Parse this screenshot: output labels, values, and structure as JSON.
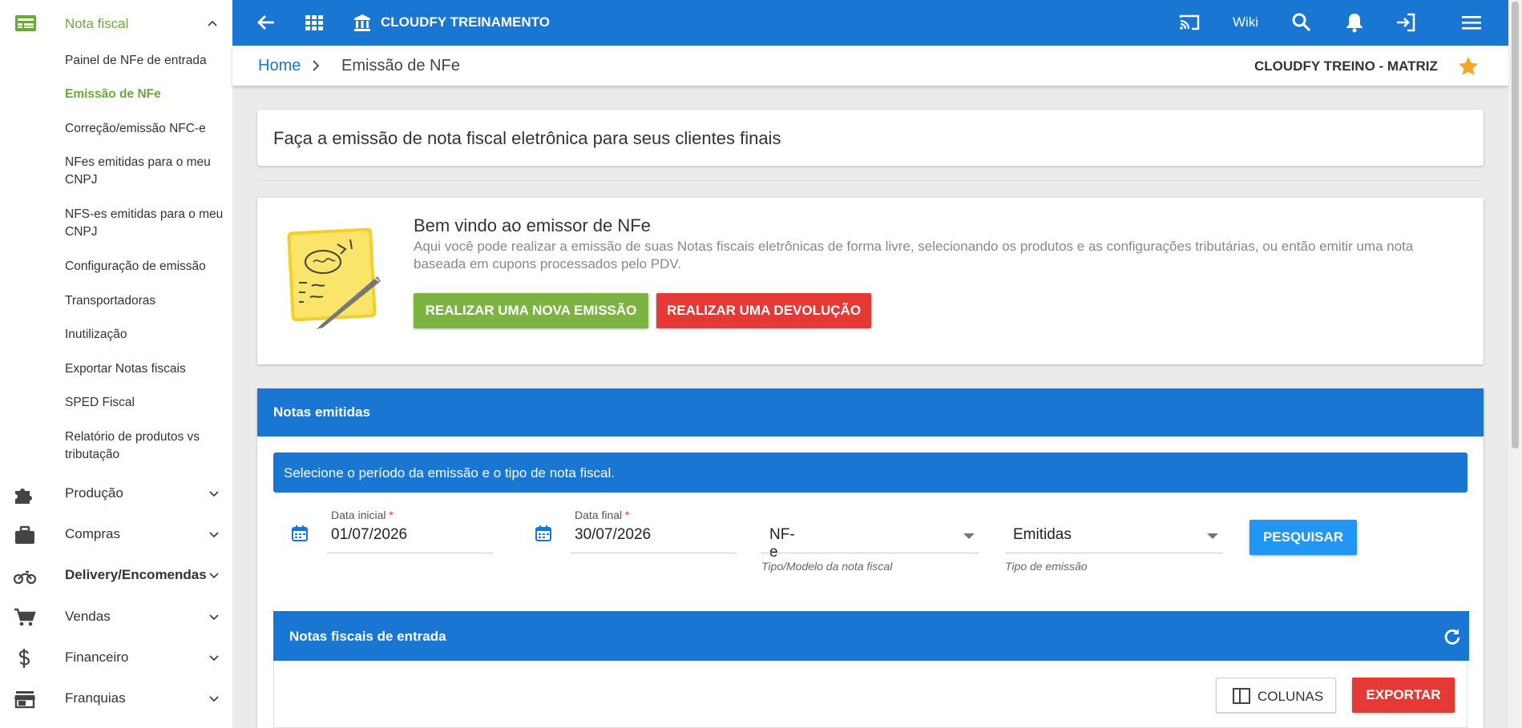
{
  "sidebar": {
    "section_title": "Nota fiscal",
    "sub_items": [
      {
        "label": "Painel de NFe de entrada",
        "active": false
      },
      {
        "label": "Emissão de NFe",
        "active": true
      },
      {
        "label": "Correção/emissão NFC-e",
        "active": false
      },
      {
        "label": "NFes emitidas para o meu CNPJ",
        "active": false
      },
      {
        "label": "NFS-es emitidas para o meu CNPJ",
        "active": false
      },
      {
        "label": "Configuração de emissão",
        "active": false
      },
      {
        "label": "Transportadoras",
        "active": false
      },
      {
        "label": "Inutilização",
        "active": false
      },
      {
        "label": "Exportar Notas fiscais",
        "active": false
      },
      {
        "label": "SPED Fiscal",
        "active": false
      },
      {
        "label": "Relatório de produtos vs tributação",
        "active": false
      }
    ],
    "sections": [
      {
        "label": "Produção",
        "icon": "puzzle-icon"
      },
      {
        "label": "Compras",
        "icon": "briefcase-icon"
      },
      {
        "label": "Delivery/Encomendas",
        "icon": "motorcycle-icon"
      },
      {
        "label": "Vendas",
        "icon": "cart-icon"
      },
      {
        "label": "Financeiro",
        "icon": "dollar-icon"
      },
      {
        "label": "Franquias",
        "icon": "store-icon"
      }
    ],
    "accent": "#6aaa3a"
  },
  "topbar": {
    "brand": "CLOUDFY TREINAMENTO",
    "wiki": "Wiki",
    "color": "#1976d2"
  },
  "breadcrumb": {
    "home": "Home",
    "current": "Emissão de NFe",
    "company": "CLOUDFY TREINO - MATRIZ"
  },
  "intro": {
    "text": "Faça a emissão de nota fiscal eletrônica para seus clientes finais"
  },
  "welcome": {
    "title": "Bem vindo ao emissor de NFe",
    "description": "Aqui você pode realizar a emissão de suas Notas fiscais eletrônicas de forma livre, selecionando os produtos e as configurações tributárias, ou então emitir uma nota baseada em cupons processados pelo PDV.",
    "new_button": "REALIZAR UMA NOVA EMISSÃO",
    "return_button": "REALIZAR UMA DEVOLUÇÃO"
  },
  "notas": {
    "header": "Notas emitidas",
    "info": "Selecione o período da emissão e o tipo de nota fiscal.",
    "start_label": "Data inicial",
    "start_value": "01/07/2026",
    "end_label": "Data final",
    "end_value": "30/07/2026",
    "required_mark": "*",
    "model_value": "NF-e",
    "model_hint": "Tipo/Modelo da nota fiscal",
    "type_value": "Emitidas",
    "type_hint": "Tipo de emissão",
    "search_button": "PESQUISAR"
  },
  "entrada": {
    "header": "Notas fiscais de entrada",
    "columns_button": "COLUNAS",
    "export_button": "EXPORTAR"
  }
}
